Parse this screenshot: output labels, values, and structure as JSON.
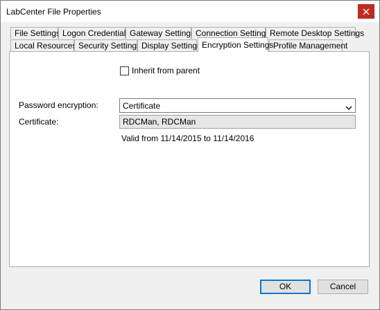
{
  "window": {
    "title": "LabCenter File Properties",
    "close_icon": "close-icon"
  },
  "tabs": {
    "row1": [
      {
        "label": "File Settings"
      },
      {
        "label": "Logon Credentials"
      },
      {
        "label": "Gateway Settings"
      },
      {
        "label": "Connection Settings"
      },
      {
        "label": "Remote Desktop Settings"
      }
    ],
    "row2": [
      {
        "label": "Local Resources"
      },
      {
        "label": "Security Settings"
      },
      {
        "label": "Display Settings"
      },
      {
        "label": "Encryption Settings",
        "active": true
      },
      {
        "label": "Profile Management"
      }
    ]
  },
  "encryption": {
    "inherit_label": "Inherit from parent",
    "inherit_checked": false,
    "password_label": "Password encryption:",
    "password_value": "Certificate",
    "certificate_label": "Certificate:",
    "certificate_value": "RDCMan, RDCMan",
    "valid_text": "Valid from 11/14/2015 to 11/14/2016"
  },
  "buttons": {
    "ok": "OK",
    "cancel": "Cancel"
  },
  "colors": {
    "close_button": "#c42b1c",
    "default_button_border": "#0078d7"
  }
}
